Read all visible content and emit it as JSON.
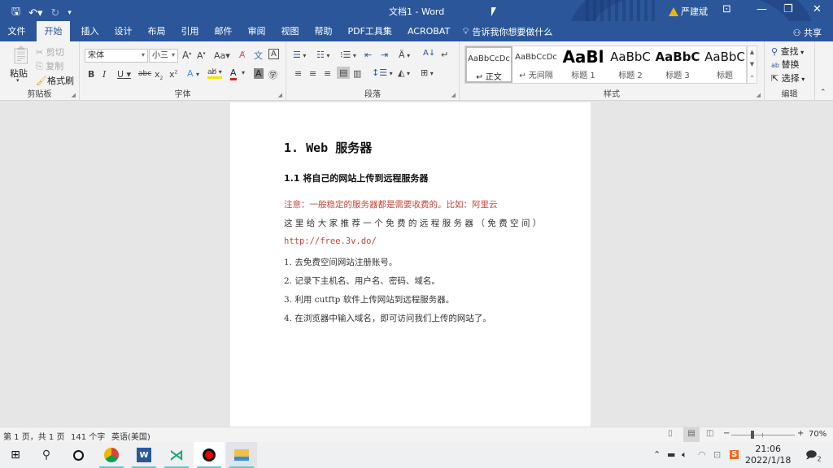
{
  "window": {
    "title": "文档1  -  Word",
    "user_name": "严建斌",
    "quick_access": {
      "save_icon": "save-icon",
      "undo_icon": "undo-icon",
      "redo_icon": "redo-icon",
      "customize_icon": "customize-icon"
    }
  },
  "tabs": [
    "文件",
    "开始",
    "插入",
    "设计",
    "布局",
    "引用",
    "邮件",
    "审阅",
    "视图",
    "帮助",
    "PDF工具集",
    "ACROBAT"
  ],
  "active_tab": "开始",
  "tell_me": "告诉我你想要做什么",
  "share": "共享",
  "ribbon": {
    "clipboard": {
      "label": "剪贴板",
      "paste": "粘贴",
      "cut": "剪切",
      "copy": "复制",
      "format_painter": "格式刷"
    },
    "font": {
      "label": "字体",
      "font_name": "宋体",
      "font_size": "小三"
    },
    "paragraph": {
      "label": "段落"
    },
    "styles": {
      "label": "样式",
      "items": [
        {
          "preview": "AaBbCcDc",
          "name": "↵ 正文"
        },
        {
          "preview": "AaBbCcDc",
          "name": "↵ 无间隔"
        },
        {
          "preview": "AaBl",
          "name": "标题 1"
        },
        {
          "preview": "AaBbC",
          "name": "标题 2"
        },
        {
          "preview": "AaBbC",
          "name": "标题 3"
        },
        {
          "preview": "AaBbC",
          "name": "标题"
        }
      ]
    },
    "editing": {
      "label": "编辑",
      "find": "查找",
      "replace": "替换",
      "select": "选择"
    }
  },
  "document": {
    "heading1": "1.  Web  服务器",
    "heading2": "1.1  将自己的网站上传到远程服务器",
    "note": "注意：一般稳定的服务器都是需要收费的。比如：阿里云",
    "recommend": "这里给大家推荐一个免费的远程服务器（免费空间）",
    "url": "http://free.3v.do/",
    "steps": [
      "1.  去免费空间网站注册账号。",
      "2.  记录下主机名、用户名、密码、域名。",
      "3.  利用  cutftp 软件上传网站到远程服务器。",
      "4.  在浏览器中输入域名，即可访问我们上传的网站了。"
    ]
  },
  "status": {
    "page": "第 1 页，共 1 页",
    "words": "141 个字",
    "language": "英语(美国)",
    "zoom": "70%",
    "zoom_percent": 70
  },
  "taskbar": {
    "time": "21:06",
    "date": "2022/1/18",
    "notifications": "2"
  },
  "colors": {
    "brand": "#2b579a",
    "note_red": "#c8453a"
  }
}
